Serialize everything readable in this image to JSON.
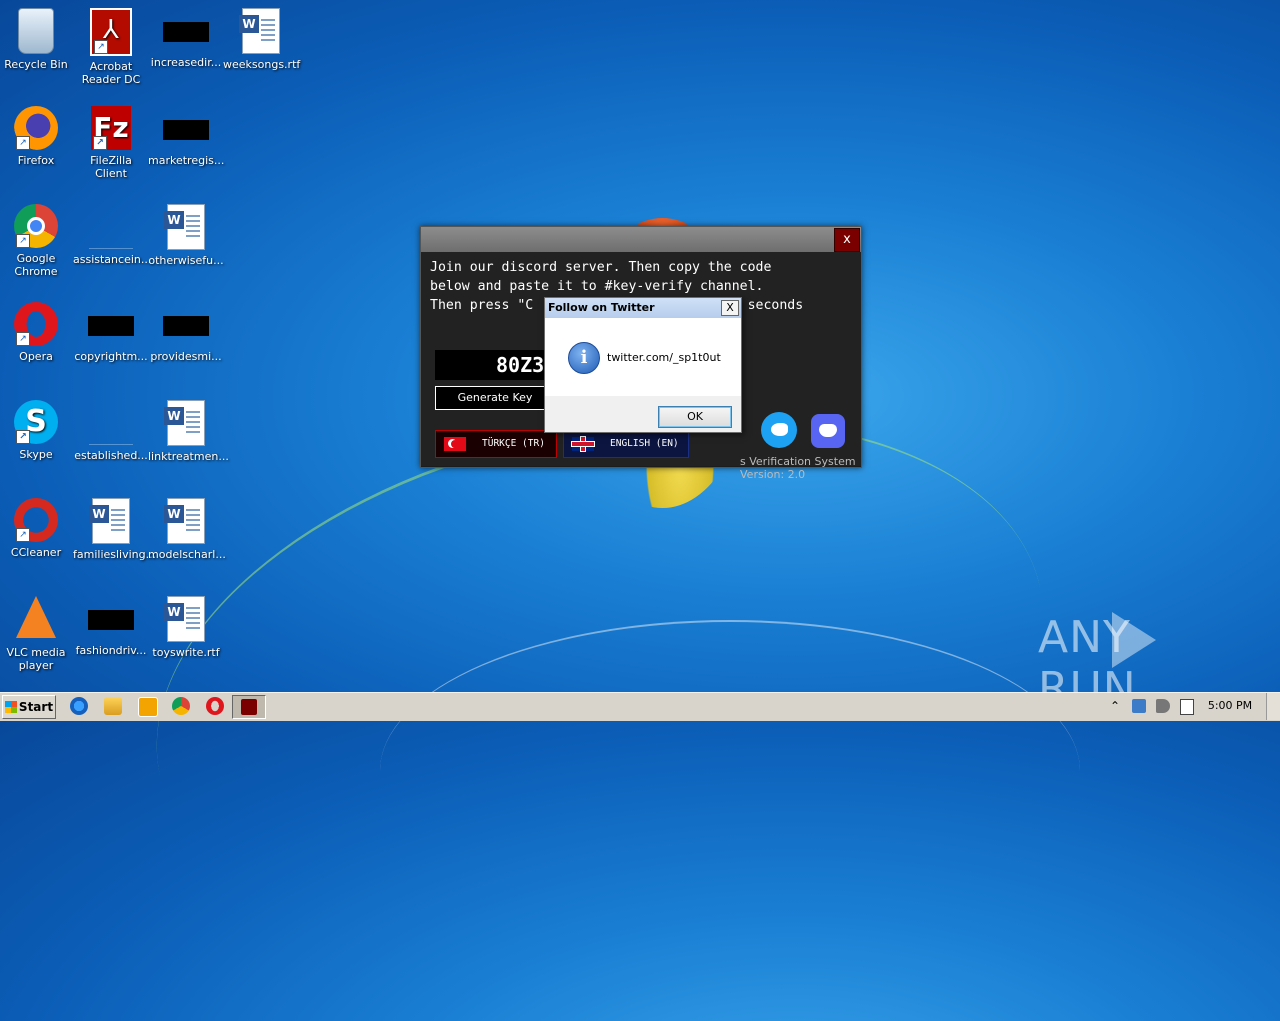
{
  "desktop": {
    "icons": [
      {
        "label": "Recycle Bin"
      },
      {
        "label": "Acrobat Reader DC"
      },
      {
        "label": "increasedir..."
      },
      {
        "label": "weeksongs.rtf"
      },
      {
        "label": "Firefox"
      },
      {
        "label": "FileZilla Client"
      },
      {
        "label": "marketregis..."
      },
      {
        "label": "Google Chrome"
      },
      {
        "label": "assistancein..."
      },
      {
        "label": "otherwisefu..."
      },
      {
        "label": "Opera"
      },
      {
        "label": "copyrightm..."
      },
      {
        "label": "providesmi..."
      },
      {
        "label": "Skype"
      },
      {
        "label": "established..."
      },
      {
        "label": "linktreatmen..."
      },
      {
        "label": "CCleaner"
      },
      {
        "label": "familiesliving..."
      },
      {
        "label": "modelscharl..."
      },
      {
        "label": "VLC media player"
      },
      {
        "label": "fashiondriv..."
      },
      {
        "label": "toyswrite.rtf"
      }
    ]
  },
  "app_window": {
    "close_label": "x",
    "instructions": "Join our discord server. Then copy the code\nbelow and paste it to #key-verify channel.\nThen press \"C                           seconds",
    "code_value": "80Z3",
    "generate_button": "Generate Key",
    "lang_tr": "TÜRKÇE (TR)",
    "lang_en": "ENGLISH (EN)",
    "system_name": "s Verification System",
    "version": "Version: 2.0"
  },
  "message_box": {
    "title": "Follow on Twitter",
    "close_label": "X",
    "message": "twitter.com/_sp1t0ut",
    "ok_label": "OK"
  },
  "watermark": {
    "left": "ANY",
    "right": "RUN"
  },
  "taskbar": {
    "start_label": "Start",
    "clock": "5:00 PM",
    "tray_arrow": "⌃"
  }
}
